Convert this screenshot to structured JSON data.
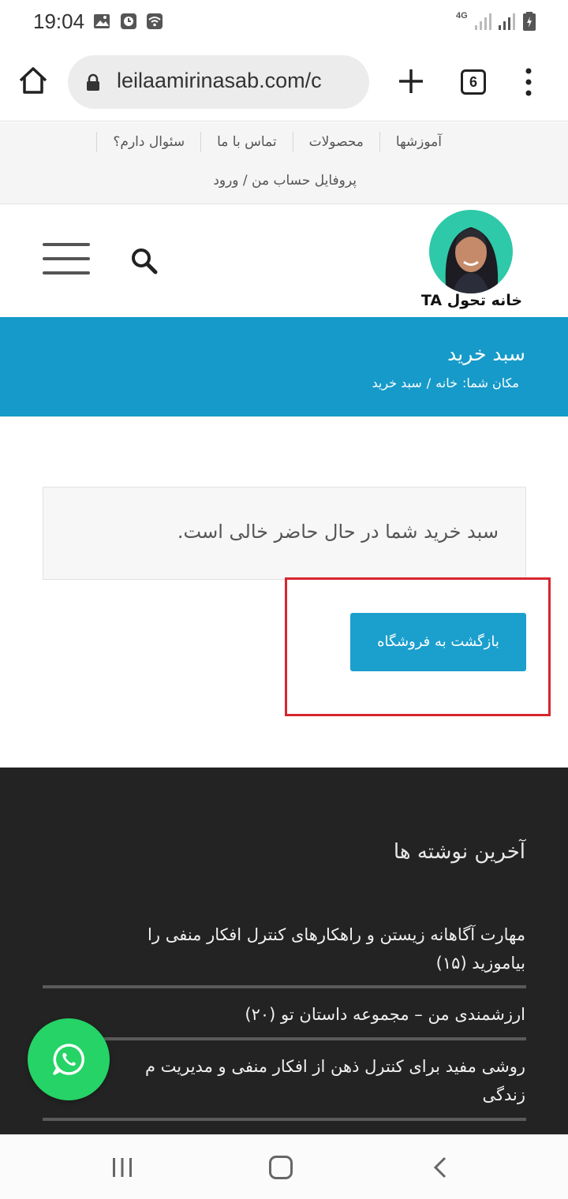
{
  "status_bar": {
    "time": "19:04",
    "network": "4G",
    "icons": [
      "image-icon",
      "clock-icon",
      "wifi-icon",
      "signal-icon",
      "battery-icon"
    ]
  },
  "browser": {
    "url": "leilaamirinasab.com/c",
    "tab_count": "6",
    "icons": [
      "home-icon",
      "lock-icon",
      "plus-icon",
      "more-vert-icon"
    ]
  },
  "top_nav": {
    "items": [
      "آموزشها",
      "محصولات",
      "تماس با ما",
      "سئوال دارم؟"
    ],
    "account_link": "پروفایل حساب من / ورود"
  },
  "header": {
    "logo_text": "خانه تحول TA",
    "icons": [
      "search-icon",
      "hamburger-menu-icon"
    ]
  },
  "page": {
    "title": "سبد خرید",
    "breadcrumb_prefix": "مکان شما:",
    "breadcrumb_home": "خانه",
    "breadcrumb_separator": "/",
    "breadcrumb_current": "سبد خرید"
  },
  "cart": {
    "empty_message": "سبد خرید شما در حال حاضر خالی است.",
    "return_button": "بازگشت به فروشگاه"
  },
  "footer": {
    "recent_posts_title": "آخرین نوشته ها",
    "posts": [
      {
        "line1": "مهارت آگاهانه زیستن و راهکارهای کنترل افکار منفی را",
        "line2": "بیاموزید (۱۵)"
      },
      {
        "line1": "ارزشمندی من – مجموعه داستان تو (۲۰)",
        "line2": ""
      },
      {
        "line1": "روشی مفید برای کنترل ذهن از افکار منفی و مدیریت م",
        "line2": "زندگی"
      }
    ]
  },
  "colors": {
    "accent_blue": "#169ac9",
    "button_blue": "#1b9fcd",
    "highlight_red": "#d7262e",
    "footer_bg": "#232323",
    "whatsapp_green": "#25d366"
  }
}
